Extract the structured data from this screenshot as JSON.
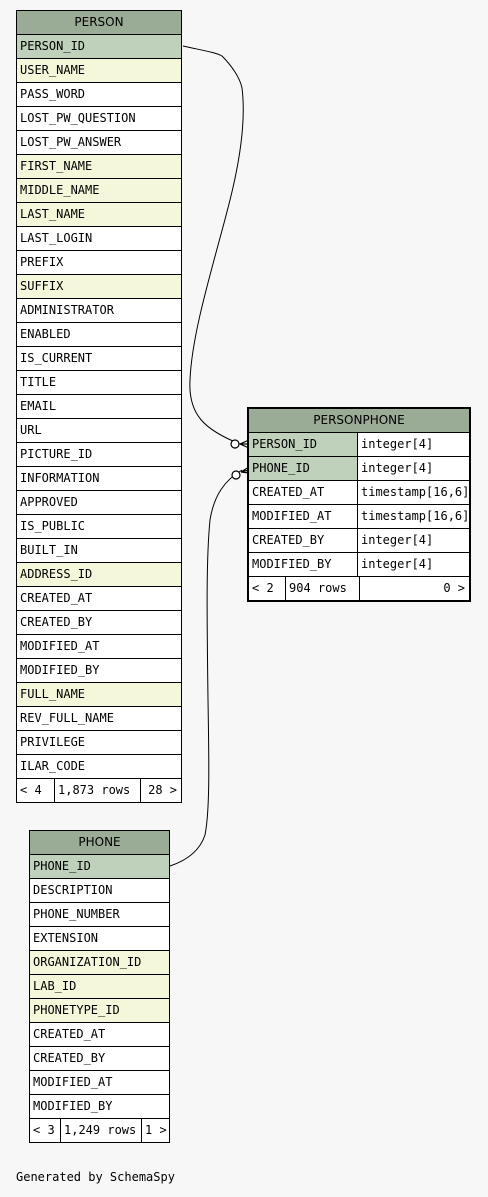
{
  "tables": {
    "person": {
      "name": "PERSON",
      "columns": [
        {
          "name": "PERSON_ID",
          "kind": "pk"
        },
        {
          "name": "USER_NAME",
          "kind": "fk"
        },
        {
          "name": "PASS_WORD",
          "kind": ""
        },
        {
          "name": "LOST_PW_QUESTION",
          "kind": ""
        },
        {
          "name": "LOST_PW_ANSWER",
          "kind": ""
        },
        {
          "name": "FIRST_NAME",
          "kind": "fk"
        },
        {
          "name": "MIDDLE_NAME",
          "kind": "fk"
        },
        {
          "name": "LAST_NAME",
          "kind": "fk"
        },
        {
          "name": "LAST_LOGIN",
          "kind": ""
        },
        {
          "name": "PREFIX",
          "kind": ""
        },
        {
          "name": "SUFFIX",
          "kind": "fk"
        },
        {
          "name": "ADMINISTRATOR",
          "kind": ""
        },
        {
          "name": "ENABLED",
          "kind": ""
        },
        {
          "name": "IS_CURRENT",
          "kind": ""
        },
        {
          "name": "TITLE",
          "kind": ""
        },
        {
          "name": "EMAIL",
          "kind": ""
        },
        {
          "name": "URL",
          "kind": ""
        },
        {
          "name": "PICTURE_ID",
          "kind": ""
        },
        {
          "name": "INFORMATION",
          "kind": ""
        },
        {
          "name": "APPROVED",
          "kind": ""
        },
        {
          "name": "IS_PUBLIC",
          "kind": ""
        },
        {
          "name": "BUILT_IN",
          "kind": ""
        },
        {
          "name": "ADDRESS_ID",
          "kind": "fk"
        },
        {
          "name": "CREATED_AT",
          "kind": ""
        },
        {
          "name": "CREATED_BY",
          "kind": ""
        },
        {
          "name": "MODIFIED_AT",
          "kind": ""
        },
        {
          "name": "MODIFIED_BY",
          "kind": ""
        },
        {
          "name": "FULL_NAME",
          "kind": "fk"
        },
        {
          "name": "REV_FULL_NAME",
          "kind": ""
        },
        {
          "name": "PRIVILEGE",
          "kind": ""
        },
        {
          "name": "ILAR_CODE",
          "kind": ""
        }
      ],
      "footer": {
        "parents": "< 4",
        "rows": "1,873 rows",
        "children": "28 >"
      }
    },
    "personphone": {
      "name": "PERSONPHONE",
      "columns": [
        {
          "name": "PERSON_ID",
          "type": "integer[4]",
          "kind": "pk"
        },
        {
          "name": "PHONE_ID",
          "type": "integer[4]",
          "kind": "pk"
        },
        {
          "name": "CREATED_AT",
          "type": "timestamp[16,6]",
          "kind": ""
        },
        {
          "name": "MODIFIED_AT",
          "type": "timestamp[16,6]",
          "kind": ""
        },
        {
          "name": "CREATED_BY",
          "type": "integer[4]",
          "kind": ""
        },
        {
          "name": "MODIFIED_BY",
          "type": "integer[4]",
          "kind": ""
        }
      ],
      "footer": {
        "parents": "< 2",
        "rows": "904 rows",
        "children": "0 >"
      }
    },
    "phone": {
      "name": "PHONE",
      "columns": [
        {
          "name": "PHONE_ID",
          "kind": "pk"
        },
        {
          "name": "DESCRIPTION",
          "kind": ""
        },
        {
          "name": "PHONE_NUMBER",
          "kind": ""
        },
        {
          "name": "EXTENSION",
          "kind": ""
        },
        {
          "name": "ORGANIZATION_ID",
          "kind": "fk"
        },
        {
          "name": "LAB_ID",
          "kind": "fk"
        },
        {
          "name": "PHONETYPE_ID",
          "kind": "fk"
        },
        {
          "name": "CREATED_AT",
          "kind": ""
        },
        {
          "name": "CREATED_BY",
          "kind": ""
        },
        {
          "name": "MODIFIED_AT",
          "kind": ""
        },
        {
          "name": "MODIFIED_BY",
          "kind": ""
        }
      ],
      "footer": {
        "parents": "< 3",
        "rows": "1,249 rows",
        "children": "1 >"
      }
    }
  },
  "relationships": [
    {
      "from": "person.PERSON_ID",
      "to": "personphone.PERSON_ID"
    },
    {
      "from": "phone.PHONE_ID",
      "to": "personphone.PHONE_ID"
    }
  ],
  "generated_by": "Generated by SchemaSpy"
}
